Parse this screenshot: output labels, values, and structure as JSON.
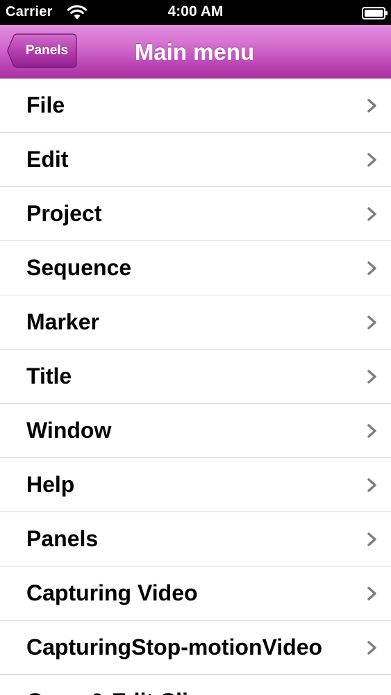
{
  "status_bar": {
    "carrier": "Carrier",
    "time": "4:00 AM",
    "icons": [
      "wifi-icon",
      "battery-icon"
    ]
  },
  "nav_bar": {
    "back_label": "Panels",
    "title": "Main menu",
    "color": "#c357bf"
  },
  "menu": {
    "items": [
      {
        "label": "File"
      },
      {
        "label": "Edit"
      },
      {
        "label": "Project"
      },
      {
        "label": "Sequence"
      },
      {
        "label": "Marker"
      },
      {
        "label": "Title"
      },
      {
        "label": "Window"
      },
      {
        "label": "Help"
      },
      {
        "label": "Panels"
      },
      {
        "label": "Capturing Video"
      },
      {
        "label": "CapturingStop-motionVideo"
      },
      {
        "label": "Open & Edit Clip"
      }
    ],
    "disclosure_icon": "chevron-right-icon"
  }
}
